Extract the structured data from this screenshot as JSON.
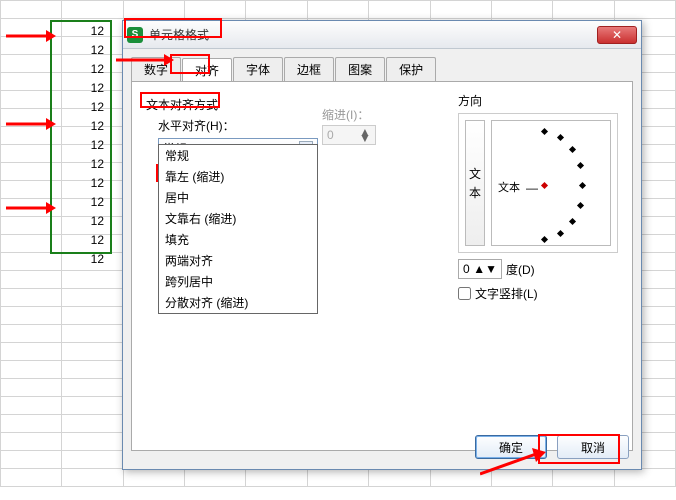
{
  "window": {
    "title": "单元格格式",
    "close": "✕"
  },
  "tabs": {
    "number": "数字",
    "align": "对齐",
    "font": "字体",
    "border": "边框",
    "pattern": "图案",
    "protect": "保护"
  },
  "align": {
    "section": "文本对齐方式",
    "h_label": "水平对齐(H)：",
    "h_value": "常规",
    "options": {
      "o1": "常规",
      "o2": "靠左 (缩进)",
      "o3": "居中",
      "o4": "文靠右 (缩进)",
      "o5": "填充",
      "o6": "两端对齐",
      "o7": "跨列居中",
      "o8": "分散对齐 (缩进)"
    },
    "indent_label": "缩进(I)：",
    "indent_value": "0"
  },
  "direction": {
    "label": "方向",
    "vtext1": "文",
    "vtext2": "本",
    "htext": "文本",
    "deg_value": "0",
    "deg_label": "度(D)",
    "vert_chk": "文字竖排(L)"
  },
  "buttons": {
    "ok": "确定",
    "cancel": "取消"
  },
  "cells": {
    "v": "12"
  }
}
